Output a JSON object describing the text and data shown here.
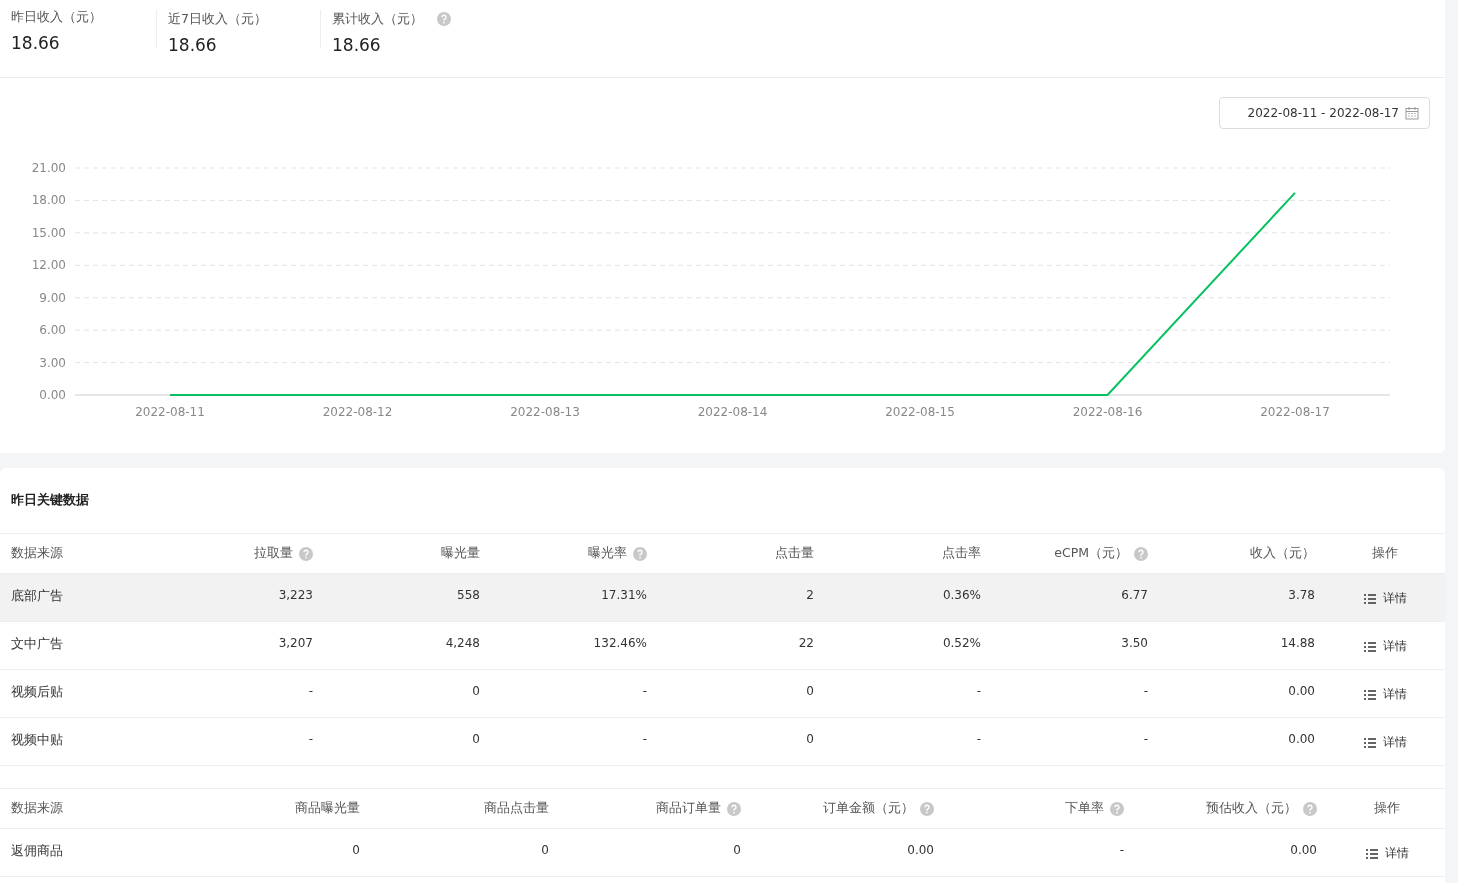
{
  "stats": [
    {
      "label": "昨日收入（元）",
      "value": "18.66",
      "help": false
    },
    {
      "label": "近7日收入（元）",
      "value": "18.66",
      "help": false
    },
    {
      "label": "累计收入（元）",
      "value": "18.66",
      "help": true
    }
  ],
  "date_range": "2022-08-11 - 2022-08-17",
  "chart_data": {
    "type": "line",
    "categories": [
      "2022-08-11",
      "2022-08-12",
      "2022-08-13",
      "2022-08-14",
      "2022-08-15",
      "2022-08-16",
      "2022-08-17"
    ],
    "series": [
      {
        "color": "#07c160",
        "values": [
          0,
          0,
          0,
          0,
          0,
          0,
          18.7
        ]
      }
    ],
    "grid": true,
    "ylim": [
      0,
      21
    ],
    "yticks": [
      {
        "value": 0,
        "label": "0.00"
      },
      {
        "value": 3,
        "label": "3.00"
      },
      {
        "value": 6,
        "label": "6.00"
      },
      {
        "value": 9,
        "label": "9.00"
      },
      {
        "value": 12,
        "label": "12.00"
      },
      {
        "value": 15,
        "label": "15.00"
      },
      {
        "value": 18,
        "label": "18.00"
      },
      {
        "value": 21,
        "label": "21.00"
      }
    ]
  },
  "section_title": "昨日关键数据",
  "ad_table": {
    "columns": [
      {
        "label": "数据来源",
        "help": false
      },
      {
        "label": "拉取量",
        "help": true
      },
      {
        "label": "曝光量",
        "help": false
      },
      {
        "label": "曝光率",
        "help": true
      },
      {
        "label": "点击量",
        "help": false
      },
      {
        "label": "点击率",
        "help": false
      },
      {
        "label": "eCPM（元）",
        "help": true
      },
      {
        "label": "收入（元）",
        "help": false
      },
      {
        "label": "操作",
        "help": false
      }
    ],
    "rows": [
      {
        "cells": [
          "底部广告",
          "3,223",
          "558",
          "17.31%",
          "2",
          "0.36%",
          "6.77",
          "3.78"
        ],
        "action": "详情",
        "selected": true
      },
      {
        "cells": [
          "文中广告",
          "3,207",
          "4,248",
          "132.46%",
          "22",
          "0.52%",
          "3.50",
          "14.88"
        ],
        "action": "详情",
        "selected": false
      },
      {
        "cells": [
          "视频后贴",
          "-",
          "0",
          "-",
          "0",
          "-",
          "-",
          "0.00"
        ],
        "action": "详情",
        "selected": false
      },
      {
        "cells": [
          "视频中贴",
          "-",
          "0",
          "-",
          "0",
          "-",
          "-",
          "0.00"
        ],
        "action": "详情",
        "selected": false
      }
    ]
  },
  "goods_table": {
    "columns": [
      {
        "label": "数据来源",
        "help": false
      },
      {
        "label": "商品曝光量",
        "help": false
      },
      {
        "label": "商品点击量",
        "help": false
      },
      {
        "label": "商品订单量",
        "help": true
      },
      {
        "label": "订单金额（元）",
        "help": true
      },
      {
        "label": "下单率",
        "help": true
      },
      {
        "label": "预估收入（元）",
        "help": true
      },
      {
        "label": "操作",
        "help": false
      }
    ],
    "rows": [
      {
        "cells": [
          "返佣商品",
          "0",
          "0",
          "0",
          "0.00",
          "-",
          "0.00"
        ],
        "action": "详情",
        "selected": false
      }
    ]
  }
}
